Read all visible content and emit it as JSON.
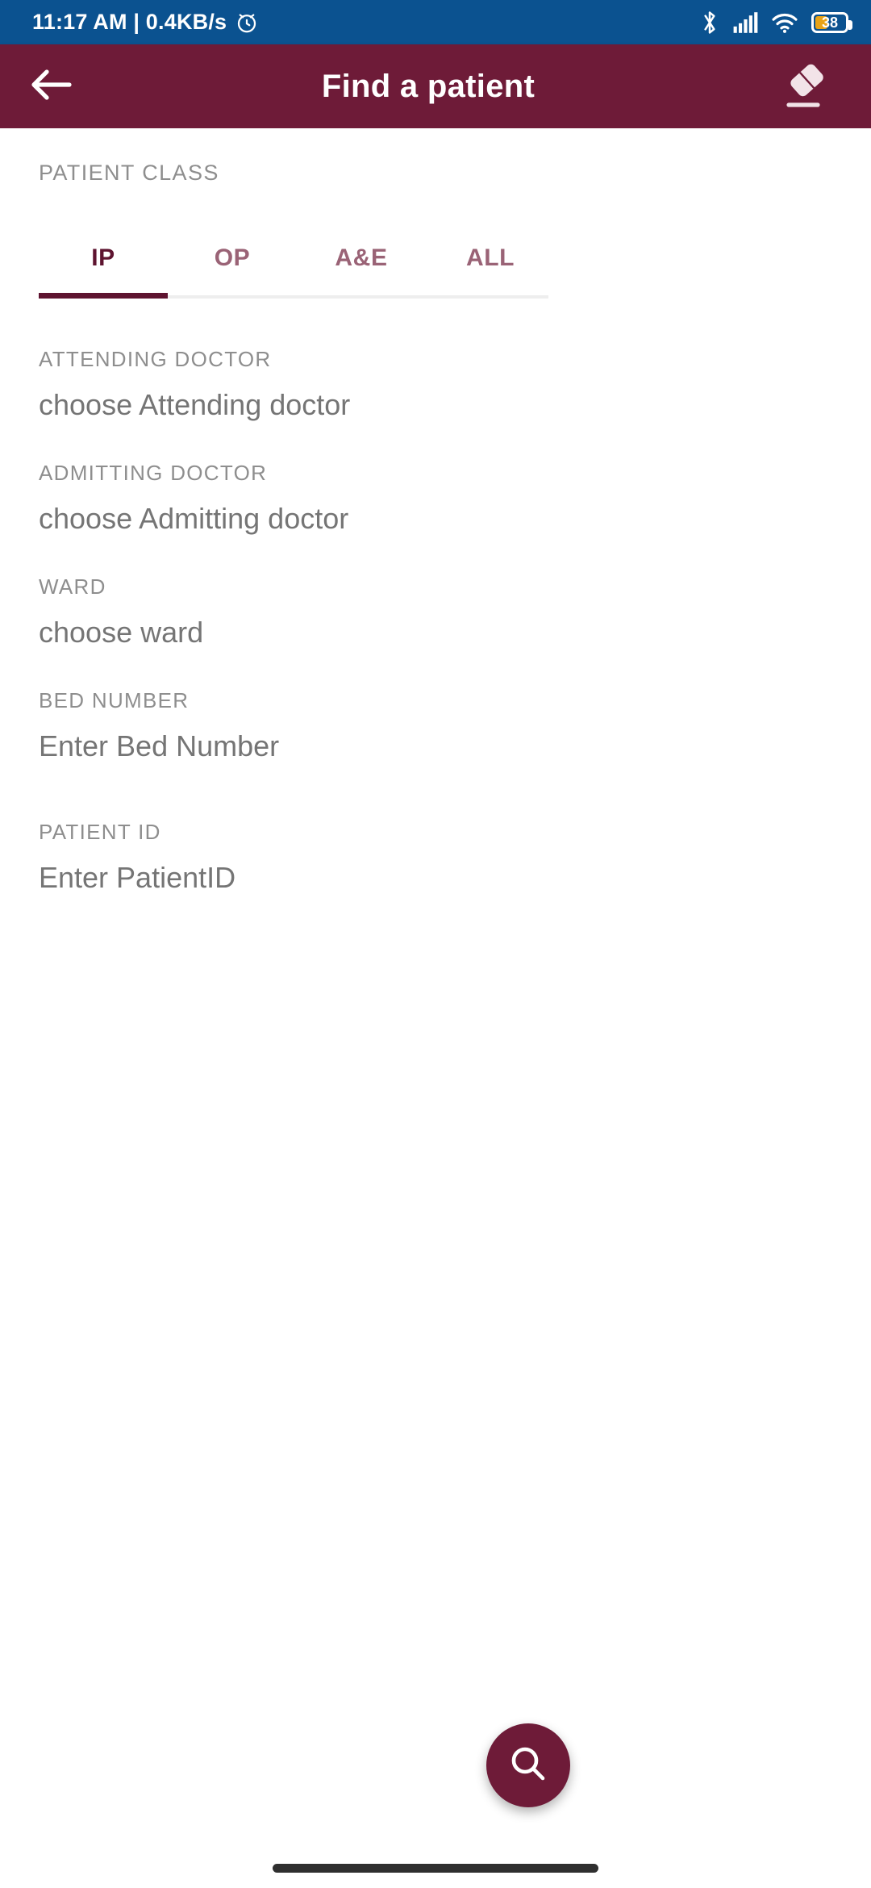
{
  "status_bar": {
    "time_and_speed": "11:17 AM | 0.4KB/s",
    "alarm_icon": "alarm-clock-icon",
    "bluetooth_icon": "bluetooth-icon",
    "signal_icon": "cellular-signal-icon",
    "wifi_icon": "wifi-icon",
    "battery_level": "38",
    "background_color": "#0b5290",
    "battery_fill_color": "#e8a317"
  },
  "app_bar": {
    "back_icon": "back-arrow-icon",
    "title": "Find a patient",
    "clear_icon": "eraser-icon",
    "background_color": "#6e1b38"
  },
  "patient_class": {
    "label": "PATIENT CLASS",
    "tabs": [
      {
        "label": "IP",
        "selected": true
      },
      {
        "label": "OP",
        "selected": false
      },
      {
        "label": "A&E",
        "selected": false
      },
      {
        "label": "ALL",
        "selected": false
      }
    ],
    "indicator_color": "#5e1430"
  },
  "form": {
    "fields": [
      {
        "label": "ATTENDING DOCTOR",
        "placeholder": "choose Attending doctor",
        "value": ""
      },
      {
        "label": "ADMITTING DOCTOR",
        "placeholder": "choose Admitting doctor",
        "value": ""
      },
      {
        "label": "WARD",
        "placeholder": "choose ward",
        "value": ""
      },
      {
        "label": "BED NUMBER",
        "placeholder": "Enter Bed Number",
        "value": ""
      },
      {
        "label": "PATIENT ID",
        "placeholder": "Enter PatientID",
        "value": ""
      }
    ]
  },
  "fab": {
    "icon": "search-icon",
    "background_color": "#6e1b38"
  },
  "navigation": {
    "home_indicator": "home-indicator-bar"
  }
}
